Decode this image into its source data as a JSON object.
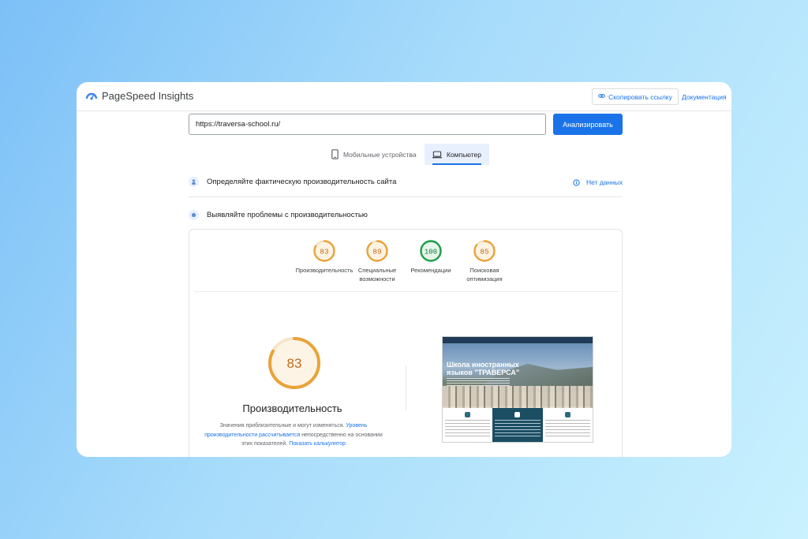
{
  "header": {
    "app_name": "PageSpeed Insights",
    "copy_link_label": "Скопировать ссылку",
    "docs_label": "Документация"
  },
  "url_bar": {
    "value": "https://traversa-school.ru/",
    "analyze_label": "Анализировать"
  },
  "tabs": [
    {
      "label": "Мобильные устройства",
      "active": false
    },
    {
      "label": "Компьютер",
      "active": true
    }
  ],
  "field_data": {
    "title": "Определяйте фактическую производительность сайта",
    "status": "Нет данных"
  },
  "lab_data": {
    "title": "Выявляйте проблемы с производительностью"
  },
  "scores": [
    {
      "value": 83,
      "label": "Производительность",
      "color": "#e8a33a"
    },
    {
      "value": 89,
      "label": "Специальные возможности",
      "color": "#e8a33a"
    },
    {
      "value": 100,
      "label": "Рекомендации",
      "color": "#1e9e4a"
    },
    {
      "value": 85,
      "label": "Поисковая оптимизация",
      "color": "#e8a33a"
    }
  ],
  "performance": {
    "score": 83,
    "title": "Производительность",
    "desc_1": "Значения приблизительные и могут изменяться. ",
    "desc_link_1": "Уровень производительности рассчитывается",
    "desc_2": " непосредственно на основании этих показателей. ",
    "desc_link_2": "Показать калькулятор"
  },
  "site_preview": {
    "title": "Школа иностранных языков \"ТРАВЕРСА\""
  },
  "colors": {
    "accent": "#1a73e8",
    "average": "#e8a33a",
    "good": "#1e9e4a"
  }
}
